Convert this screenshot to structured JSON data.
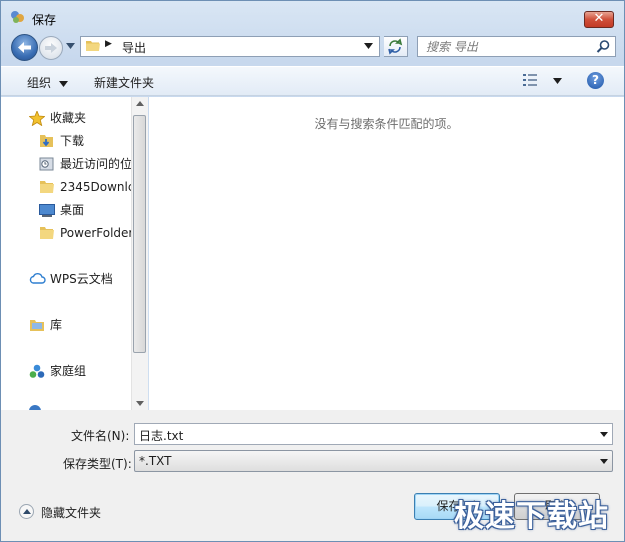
{
  "window": {
    "title": "保存",
    "close_label": "✕"
  },
  "address": {
    "current_folder": "导出"
  },
  "search": {
    "placeholder": "搜索 导出"
  },
  "toolbar": {
    "organize_label": "组织",
    "new_folder_label": "新建文件夹",
    "help_label": "?"
  },
  "nav": {
    "favorites": "收藏夹",
    "items": [
      "下载",
      "最近访问的位",
      "2345Downlc",
      "桌面",
      "PowerFolder"
    ],
    "wps": "WPS云文档",
    "library": "库",
    "homegroup": "家庭组"
  },
  "filelist": {
    "empty_message": "没有与搜索条件匹配的项。"
  },
  "form": {
    "filename_label": "文件名(N):",
    "filename_value": "日志.txt",
    "filetype_label": "保存类型(T):",
    "filetype_value": "*.TXT"
  },
  "footer": {
    "hide_folders_label": "隐藏文件夹",
    "save_label": "保存(S)",
    "cancel_label": "取消"
  },
  "watermark": "极速下载站",
  "colors": {
    "accent": "#3c7fb1",
    "chrome": "#d2e1f2",
    "close": "#c23a26"
  }
}
